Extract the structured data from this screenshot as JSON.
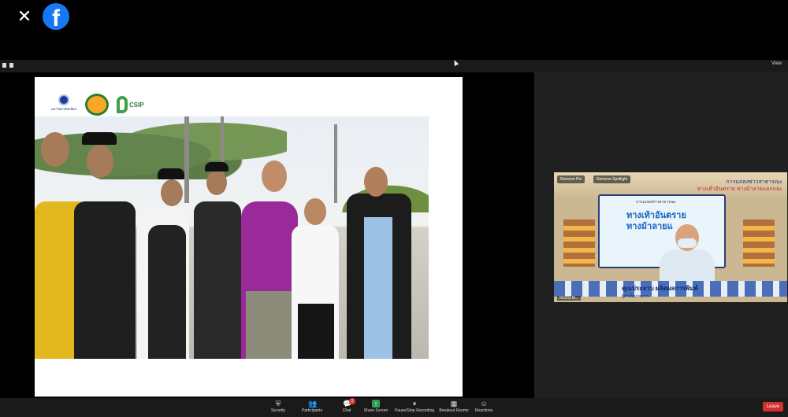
{
  "facebook": {
    "close_glyph": "✕",
    "logo_glyph": "f",
    "brand_color": "#1877f2"
  },
  "zoom": {
    "view_label": "View"
  },
  "slide": {
    "logo_a_text": "มหาวิทยาลัยมหิดล",
    "logo_c_text": "CSIP"
  },
  "thumbnail": {
    "chip_1": "Remove Pin",
    "chip_2": "Remove Spotlight",
    "title_line_1": "การแถลงข่าวสาธารณะ",
    "title_line_2": "ทางเท้าอันตราย ทางม้าลายแยกแยะ",
    "poster_small": "การแถลงข่าวสาธารณะ",
    "poster_line_1": "ทางเท้าอันตราย",
    "poster_line_2": "ทางม้าลายแ",
    "presenter_name": "คุณประจวบ ผลิตผลการพิมพ์",
    "presenter_role": "ผู้ดำเนินรายการ",
    "participant_name": "NCDS M..."
  },
  "toolbar": {
    "items": [
      {
        "label": "Security",
        "icon": "shield-icon"
      },
      {
        "label": "Participants",
        "icon": "participants-icon",
        "count": "27"
      },
      {
        "label": "Chat",
        "icon": "chat-icon",
        "badge": "1"
      },
      {
        "label": "Share Screen",
        "icon": "share-screen-icon"
      },
      {
        "label": "Pause/Stop Recording",
        "icon": "recording-icon"
      },
      {
        "label": "Breakout Rooms",
        "icon": "breakout-icon"
      },
      {
        "label": "Reactions",
        "icon": "reactions-icon"
      }
    ],
    "leave_label": "Leave"
  },
  "colors": {
    "leave_red": "#d32f2f",
    "share_green": "#2e9e4f"
  }
}
